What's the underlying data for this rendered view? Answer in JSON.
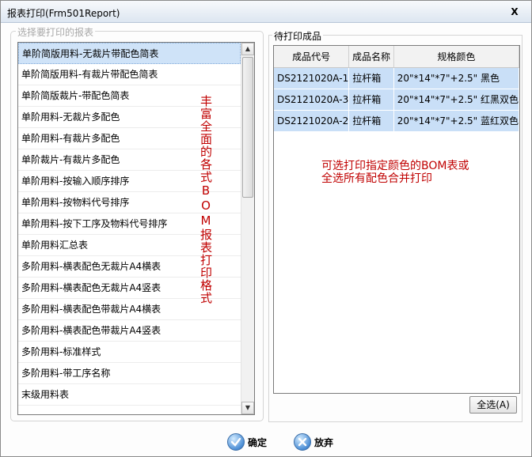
{
  "window": {
    "title": "报表打印(Frm501Report)",
    "close_label": "X"
  },
  "report_group": {
    "legend": "选择要打印的报表",
    "items": [
      {
        "label": "单阶简版用料-无裁片带配色简表"
      },
      {
        "label": "单阶简版用料-有裁片带配色简表"
      },
      {
        "label": "单阶简版裁片-带配色简表"
      },
      {
        "label": "单阶用料-无裁片多配色"
      },
      {
        "label": "单阶用料-有裁片多配色"
      },
      {
        "label": "单阶裁片-有裁片多配色"
      },
      {
        "label": "单阶用料-按输入顺序排序"
      },
      {
        "label": "单阶用料-按物料代号排序"
      },
      {
        "label": "单阶用料-按下工序及物料代号排序"
      },
      {
        "label": "单阶用料汇总表"
      },
      {
        "label": "多阶用料-横表配色无裁片A4横表"
      },
      {
        "label": "多阶用料-横表配色无裁片A4竖表"
      },
      {
        "label": "多阶用料-横表配色带裁片A4横表"
      },
      {
        "label": "多阶用料-横表配色带裁片A4竖表"
      },
      {
        "label": "多阶用料-标准样式"
      },
      {
        "label": "多阶用料-带工序名称"
      },
      {
        "label": "末级用料表"
      }
    ],
    "selected_index": 0,
    "annotation": "丰富全面的各式BOM报表打印格式"
  },
  "products_group": {
    "legend": "待打印成品",
    "columns": [
      "成品代号",
      "成品名称",
      "规格颜色"
    ],
    "rows": [
      {
        "code": "DS2121020A-1",
        "name": "拉杆箱",
        "spec": "20\"*14\"*7\"+2.5\" 黑色"
      },
      {
        "code": "DS2121020A-3",
        "name": "拉杆箱",
        "spec": "20\"*14\"*7\"+2.5\" 红黑双色"
      },
      {
        "code": "DS2121020A-2",
        "name": "拉杆箱",
        "spec": "20\"*14\"*7\"+2.5\" 蓝红双色"
      }
    ],
    "annotation_line1": "可选打印指定颜色的BOM表或",
    "annotation_line2": "全选所有配色合并打印",
    "select_all_label": "全选(A)"
  },
  "actions": {
    "ok_label": "确定",
    "cancel_label": "放弃"
  },
  "icons": {
    "up_arrow": "arrow-up-icon",
    "down_arrow": "arrow-down-icon",
    "ok": "check-icon",
    "cancel": "cancel-x-icon"
  }
}
